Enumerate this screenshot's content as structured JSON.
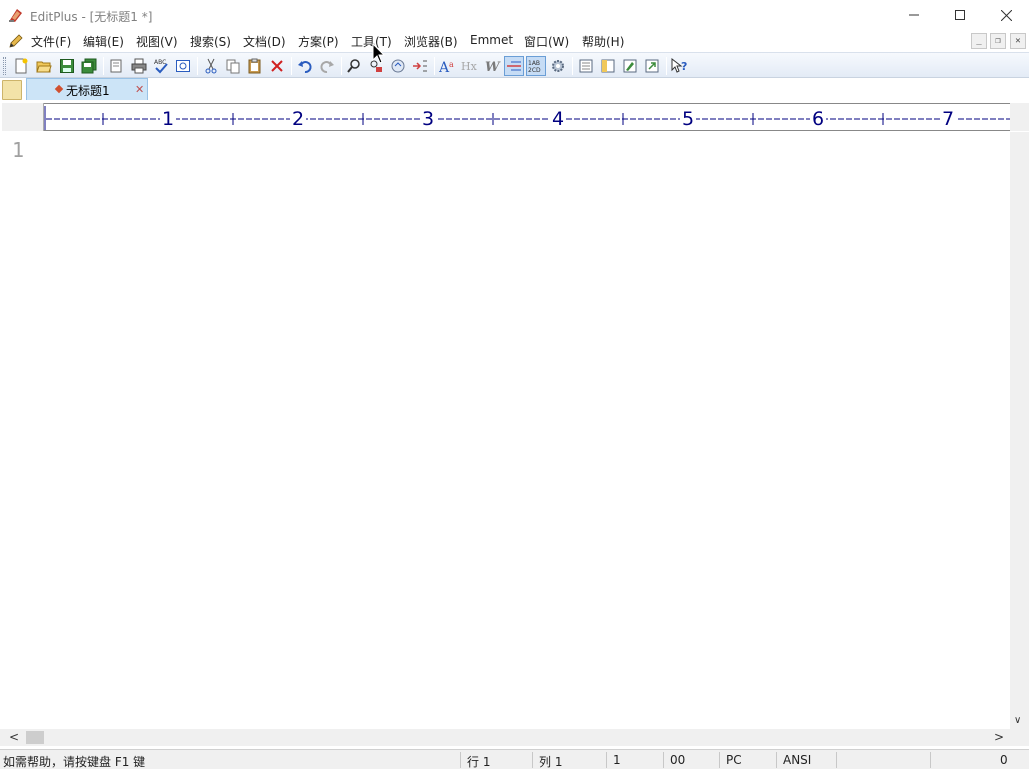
{
  "window": {
    "title": "EditPlus - [无标题1 *]",
    "controls": [
      "minimize",
      "maximize",
      "close"
    ]
  },
  "menu": {
    "items": [
      "文件(F)",
      "编辑(E)",
      "视图(V)",
      "搜索(S)",
      "文档(D)",
      "方案(P)",
      "工具(T)",
      "浏览器(B)",
      "Emmet",
      "窗口(W)",
      "帮助(H)"
    ]
  },
  "toolbar": {
    "icons": [
      "new-file-icon",
      "open-folder-icon",
      "save-icon",
      "save-all-icon",
      "print-preview-icon",
      "print-icon",
      "spell-check-icon",
      "browser-preview-icon",
      "cut-icon",
      "copy-icon",
      "paste-icon",
      "delete-icon",
      "undo-icon",
      "redo-icon",
      "find-icon",
      "replace-icon",
      "find-in-files-icon",
      "goto-line-icon",
      "font-icon",
      "hex-icon",
      "word-wrap-icon",
      "line-number-icon",
      "column-select-icon",
      "settings-gear-icon",
      "clip-text-icon",
      "directory-window-icon",
      "user-tool-icon",
      "fullscreen-icon",
      "help-icon"
    ]
  },
  "tabs": [
    {
      "label": "无标题1",
      "active": true,
      "modified": true
    }
  ],
  "ruler": {
    "labels": [
      "1",
      "2",
      "3",
      "4",
      "5",
      "6",
      "7"
    ]
  },
  "editor": {
    "line_numbers": [
      "1"
    ],
    "content": ""
  },
  "statusbar": {
    "help": "如需帮助，请按键盘 F1 键",
    "line": "行 1",
    "column": "列 1",
    "lines_total": "1",
    "char_code": "00",
    "line_ending": "PC",
    "encoding": "ANSI",
    "file_size": "0"
  },
  "colors": {
    "ruler_text": "#000080",
    "tab_active": "#cce4f7",
    "toolbar_pressed": "#c6dcf5"
  }
}
